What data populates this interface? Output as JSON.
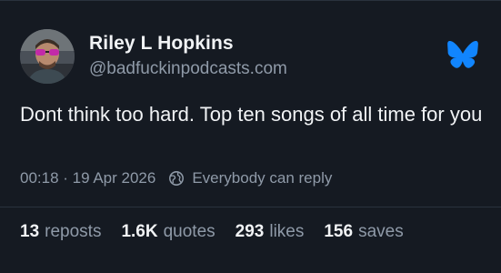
{
  "author": {
    "display_name": "Riley L Hopkins",
    "handle": "@badfuckinpodcasts.com",
    "avatar_icon": "avatar-photo"
  },
  "logo_icon": "bluesky-butterfly-icon",
  "post": {
    "text": "Dont think too hard. Top ten songs of all time for you",
    "timestamp": "00:18 · 19 Apr 2026",
    "reply_setting": "Everybody can reply",
    "reply_setting_icon": "earth-icon"
  },
  "stats": {
    "reposts": {
      "count": "13",
      "label": "reposts"
    },
    "quotes": {
      "count": "1.6K",
      "label": "quotes"
    },
    "likes": {
      "count": "293",
      "label": "likes"
    },
    "saves": {
      "count": "156",
      "label": "saves"
    }
  },
  "colors": {
    "background": "#151a22",
    "text_primary": "#f1f3f5",
    "text_secondary": "#8f9aa8",
    "brand_blue": "#1185fe"
  }
}
